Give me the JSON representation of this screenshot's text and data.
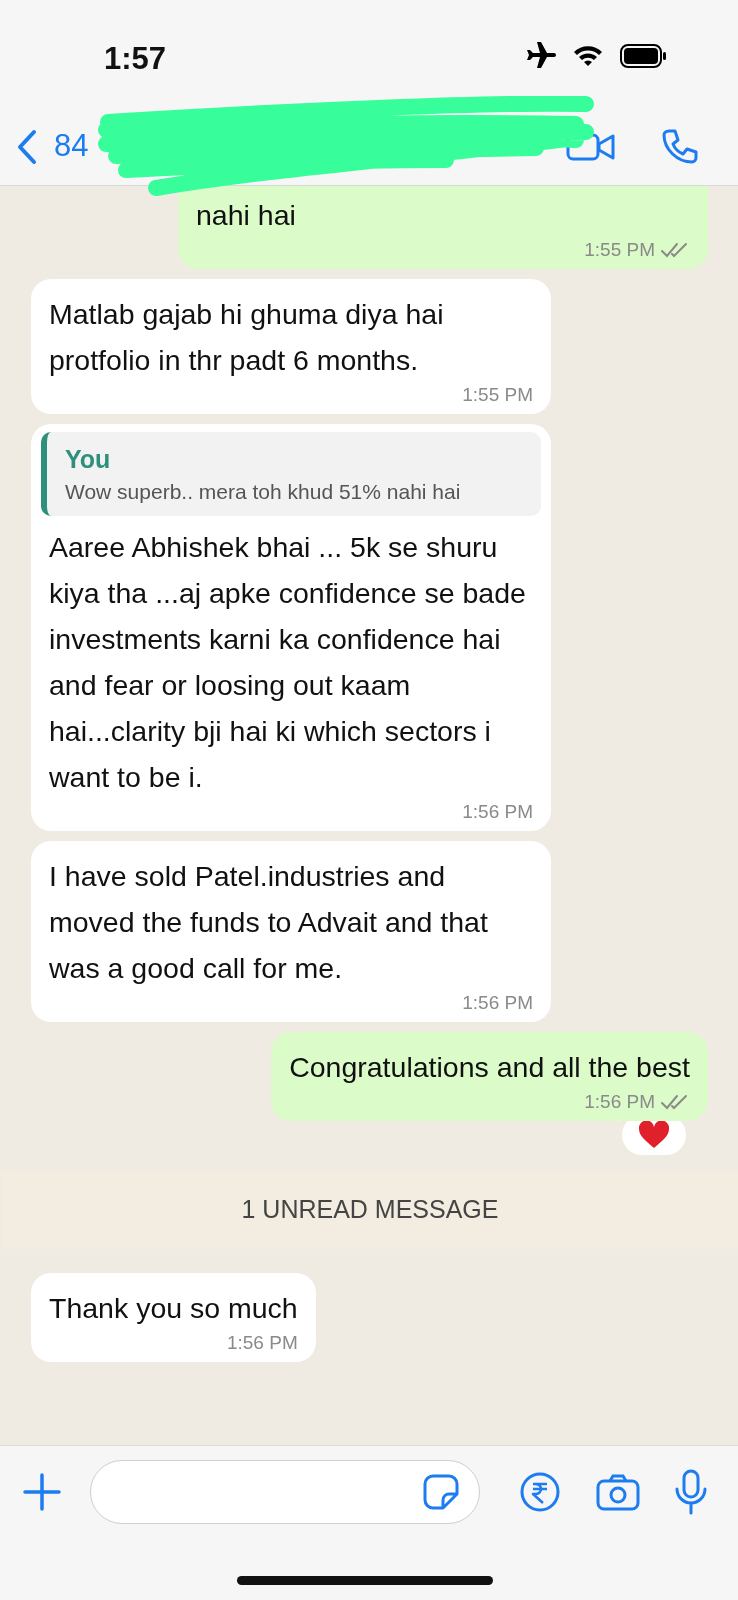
{
  "status_bar": {
    "time": "1:57"
  },
  "header": {
    "back_label": "84"
  },
  "messages": [
    {
      "outgoing": true,
      "text": "nahi hai",
      "time": "1:55 PM",
      "read": false,
      "cut_top": true
    },
    {
      "outgoing": false,
      "text": "Matlab gajab hi ghuma diya hai protfolio in thr padt 6 months.",
      "time": "1:55 PM"
    },
    {
      "outgoing": false,
      "quote": {
        "author": "You",
        "text": "Wow superb.. mera toh khud 51% nahi hai"
      },
      "text": "Aaree Abhishek bhai ... 5k se shuru kiya tha ...aj apke confidence se bade investments karni ka confidence hai and fear or loosing out kaam hai...clarity bji hai ki which sectors i want to be i.",
      "time": "1:56 PM"
    },
    {
      "outgoing": false,
      "text": "I have sold Patel.industries and moved the funds to Advait and that was a good call for me.",
      "time": "1:56 PM"
    },
    {
      "outgoing": true,
      "text": "Congratulations and all the best",
      "time": "1:56 PM",
      "read": false,
      "reacted": true
    },
    {
      "kind": "banner",
      "text": "1 UNREAD MESSAGE"
    },
    {
      "outgoing": false,
      "text": "Thank you so much",
      "time": "1:56 PM"
    }
  ]
}
